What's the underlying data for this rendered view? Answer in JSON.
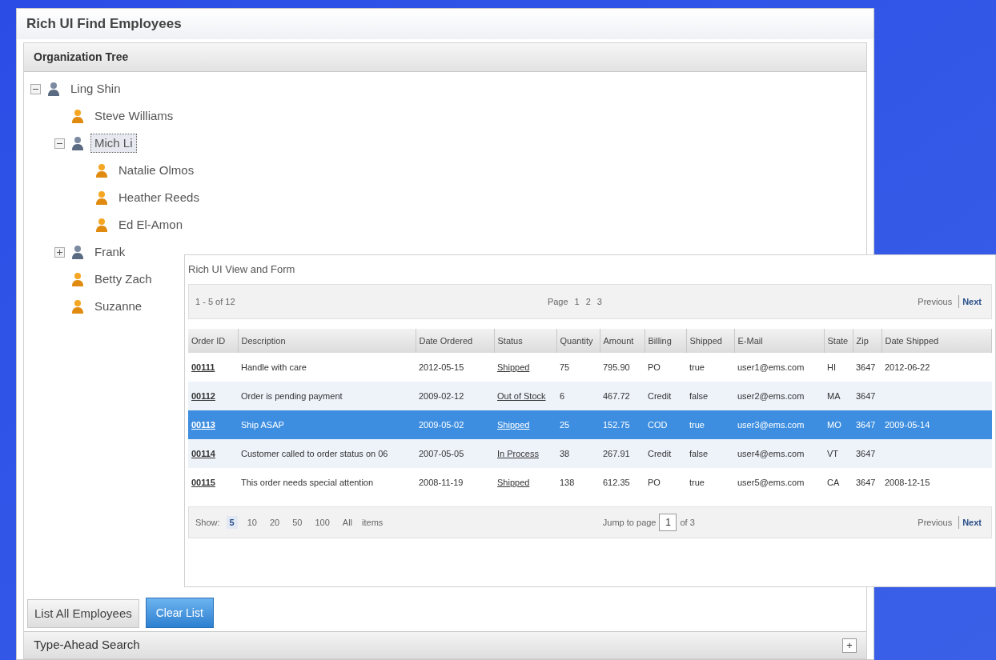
{
  "main_window": {
    "title": "Rich UI Find Employees"
  },
  "tree_panel": {
    "title": "Organization Tree",
    "items": [
      {
        "label": "Ling Shin",
        "kind": "manager",
        "expanded": true,
        "selected": false,
        "children": [
          {
            "label": "Steve Williams",
            "kind": "employee",
            "selected": false
          },
          {
            "label": "Mich Li",
            "kind": "manager",
            "expanded": true,
            "selected": true,
            "children": [
              {
                "label": "Natalie Olmos",
                "kind": "employee",
                "selected": false
              },
              {
                "label": "Heather Reeds",
                "kind": "employee",
                "selected": false
              },
              {
                "label": "Ed El-Amon",
                "kind": "employee",
                "selected": false
              }
            ]
          },
          {
            "label": "Frank",
            "kind": "manager",
            "expanded": false,
            "selected": false
          },
          {
            "label": "Betty Zach",
            "kind": "employee",
            "selected": false
          },
          {
            "label": "Suzanne",
            "kind": "employee",
            "selected": false
          }
        ]
      }
    ]
  },
  "buttons": [
    {
      "label": "List All Employees",
      "selected": false
    },
    {
      "label": "Clear List",
      "selected": true
    }
  ],
  "search_panel": {
    "title": "Type-Ahead Search",
    "toggle": "+"
  },
  "form_window": {
    "title": "Rich UI View and Form",
    "top_pager": {
      "range": "1 - 5 of 12",
      "pages": [
        "Page",
        "1",
        "2",
        "3"
      ],
      "nav": [
        "Previous",
        "Next"
      ]
    },
    "table": {
      "columns": [
        "Order ID",
        "Description",
        "Date Ordered",
        "Status",
        "Quantity",
        "Amount",
        "Billing",
        "Shipped",
        "E-Mail",
        "State",
        "Zip",
        "Date Shipped"
      ],
      "rows": [
        {
          "selected": false,
          "cells": [
            "00111",
            "Handle with care",
            "2012-05-15",
            "Shipped",
            "75",
            "795.90",
            "PO",
            "true",
            "user1@ems.com",
            "HI",
            "3647",
            "2012-06-22"
          ]
        },
        {
          "selected": false,
          "cells": [
            "00112",
            "Order is pending payment",
            "2009-02-12",
            "Out of Stock",
            "6",
            "467.72",
            "Credit",
            "false",
            "user2@ems.com",
            "MA",
            "3647"
          ]
        },
        {
          "selected": true,
          "cells": [
            "00113",
            "Ship ASAP",
            "2009-05-02",
            "Shipped",
            "25",
            "152.75",
            "COD",
            "true",
            "user3@ems.com",
            "MO",
            "3647",
            "2009-05-14"
          ]
        },
        {
          "selected": false,
          "cells": [
            "00114",
            "Customer called to order status on 06",
            "2007-05-05",
            "In Process",
            "38",
            "267.91",
            "Credit",
            "false",
            "user4@ems.com",
            "VT",
            "3647"
          ]
        },
        {
          "selected": false,
          "cells": [
            "00115",
            "This order needs special attention",
            "2008-11-19",
            "Shipped",
            "138",
            "612.35",
            "PO",
            "true",
            "user5@ems.com",
            "CA",
            "3647",
            "2008-12-15"
          ]
        }
      ]
    },
    "bottom_pager": {
      "show_label": "Show:",
      "sizes": [
        {
          "label": "5",
          "selected": true
        },
        {
          "label": "10",
          "selected": false
        },
        {
          "label": "20",
          "selected": false
        },
        {
          "label": "50",
          "selected": false
        },
        {
          "label": "100",
          "selected": false
        },
        {
          "label": "All",
          "selected": false
        }
      ],
      "items_label": "items",
      "jump_label": "Jump to page",
      "page_value": "1",
      "page_total": "of 3",
      "nav": [
        "Previous",
        "Next"
      ]
    }
  }
}
